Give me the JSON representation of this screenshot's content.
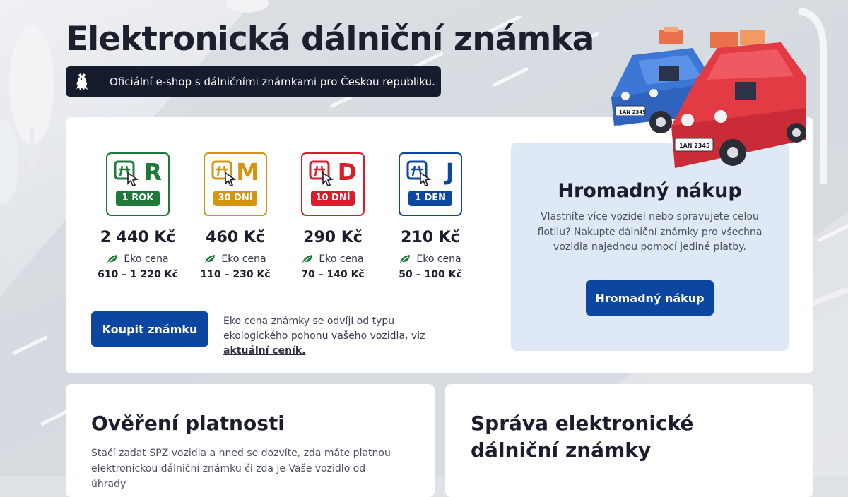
{
  "hero": {
    "title": "Elektronická dálniční známka",
    "subtitle": "Oficiální e-shop s dálničními známkami pro Českou republiku."
  },
  "vignettes": [
    {
      "letter": "R",
      "period": "1 ROK",
      "price": "2 440 Kč",
      "eco_label": "Eko cena",
      "eco_range": "610 – 1 220 Kč",
      "color": "#1f7a3a"
    },
    {
      "letter": "M",
      "period": "30 DNÍ",
      "price": "460 Kč",
      "eco_label": "Eko cena",
      "eco_range": "110 – 230 Kč",
      "color": "#d4940f"
    },
    {
      "letter": "D",
      "period": "10 DNÍ",
      "price": "290 Kč",
      "eco_label": "Eko cena",
      "eco_range": "70 – 140 Kč",
      "color": "#d61f2b"
    },
    {
      "letter": "J",
      "period": "1 DEN",
      "price": "210 Kč",
      "eco_label": "Eko cena",
      "eco_range": "50 – 100 Kč",
      "color": "#0b47a1"
    }
  ],
  "buy": {
    "button_label": "Koupit známku",
    "note_text": "Eko cena známky se odvíjí od typu ekologického pohonu vašeho vozidla, viz ",
    "note_link": "aktuální ceník."
  },
  "bulk": {
    "title": "Hromadný nákup",
    "text": "Vlastníte více vozidel nebo spravujete celou flotilu? Nakupte dálniční známky pro všechna vozidla najednou pomocí jediné platby.",
    "button_label": "Hromadný nákup"
  },
  "verify": {
    "title": "Ověření platnosti",
    "text": "Stačí zadat SPZ vozidla a hned se dozvíte, zda máte platnou elektronickou dálniční známku či zda je Vaše vozidlo od úhrady"
  },
  "manage": {
    "title": "Správa elektronické dálniční známky"
  },
  "illustration": {
    "plate_text": "1AN 2345"
  },
  "icons": {
    "emblem": "czech-lion-emblem-icon",
    "vignette": "highway-cursor-icon",
    "eco": "leaf-icon"
  },
  "colors": {
    "primary": "#0b47a1",
    "dark": "#161b2e",
    "bulk_bg": "#dfe8f5"
  }
}
